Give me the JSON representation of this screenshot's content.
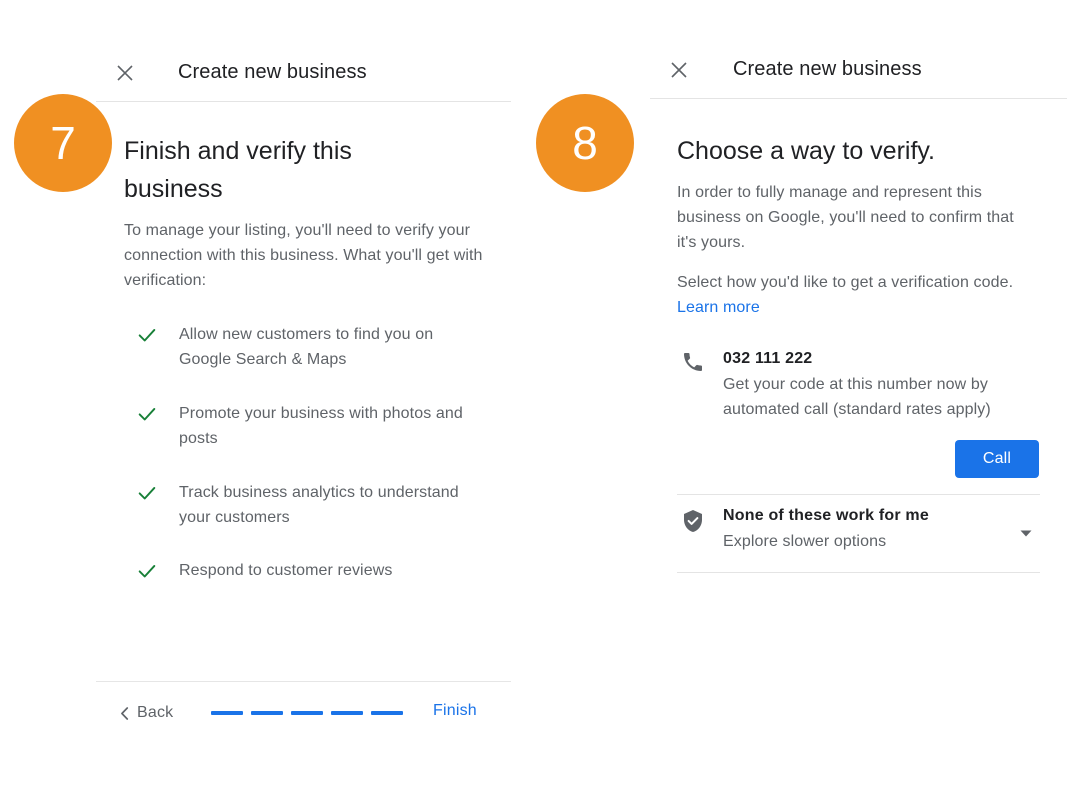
{
  "panels": [
    {
      "step": "7",
      "window_title": "Create new business",
      "close_icon": "close-icon",
      "heading": "Finish and verify this business",
      "intro": "To manage your listing, you'll need to verify your connection with this business. What you'll get with verification:",
      "benefits": [
        "Allow new customers to find you on Google Search & Maps",
        "Promote your business with photos and posts",
        "Track business analytics to understand your customers",
        "Respond to customer reviews"
      ],
      "footer": {
        "back_label": "Back",
        "back_icon": "chevron-left-icon",
        "finish_label": "Finish",
        "progress_total": 5,
        "progress_filled": 5
      }
    },
    {
      "step": "8",
      "window_title": "Create new business",
      "close_icon": "close-icon",
      "heading": "Choose a way to verify.",
      "paragraph_1": "In order to fully manage and represent this business on Google, you'll need to confirm that it's yours.",
      "paragraph_2_prefix": "Select how you'd like to get a verification code. ",
      "learn_more_label": "Learn more",
      "options": [
        {
          "icon": "phone-icon",
          "title": "032 111 222",
          "subtitle": "Get your code at this number now by automated call (standard rates apply)",
          "action_label": "Call"
        },
        {
          "icon": "shield-check-icon",
          "title": "None of these work for me",
          "subtitle": "Explore slower options",
          "expander_icon": "chevron-down-icon"
        }
      ]
    }
  ],
  "colors": {
    "accent_orange": "#F09022",
    "link_blue": "#1A73E8",
    "check_green": "#188038",
    "text_primary": "#202124",
    "text_secondary": "#5F6368",
    "divider": "#E4E4E4",
    "icon_gray": "#5F6368"
  }
}
